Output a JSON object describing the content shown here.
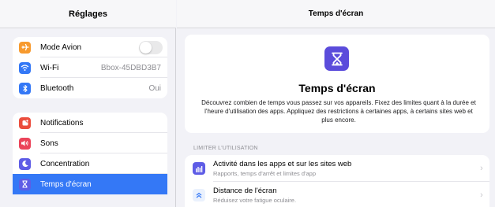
{
  "sidebar": {
    "title": "Réglages",
    "group1": [
      {
        "label": "Mode Avion",
        "value": "",
        "icon": "airplane-icon",
        "color": "#f79a2e"
      },
      {
        "label": "Wi-Fi",
        "value": "Bbox-45DBD3B7",
        "icon": "wifi-icon",
        "color": "#3478f6"
      },
      {
        "label": "Bluetooth",
        "value": "Oui",
        "icon": "bluetooth-icon",
        "color": "#3478f6"
      }
    ],
    "group2": [
      {
        "label": "Notifications",
        "icon": "notifications-icon",
        "color": "#eb4d3d"
      },
      {
        "label": "Sons",
        "icon": "sound-icon",
        "color": "#eb445a"
      },
      {
        "label": "Concentration",
        "icon": "moon-icon",
        "color": "#5e5ce6"
      },
      {
        "label": "Temps d'écran",
        "icon": "hourglass-icon",
        "color": "#5e5ce6",
        "selected": true
      }
    ]
  },
  "main": {
    "title": "Temps d'écran",
    "hero": {
      "title": "Temps d'écran",
      "description": "Découvrez combien de temps vous passez sur vos appareils. Fixez des limites quant à la durée et l'heure d'utilisation des apps. Appliquez des restrictions à certaines apps, à certains sites web et plus encore."
    },
    "section_label": "LIMITER L'UTILISATION",
    "list": [
      {
        "title": "Activité dans les apps et sur les sites web",
        "subtitle": "Rapports, temps d'arrêt et limites d'app",
        "icon": "bar-chart-icon",
        "color": "#5e5ce6"
      },
      {
        "title": "Distance de l'écran",
        "subtitle": "Réduisez votre fatigue oculaire.",
        "icon": "chevrons-up-icon",
        "color": "#3478f6"
      }
    ]
  }
}
